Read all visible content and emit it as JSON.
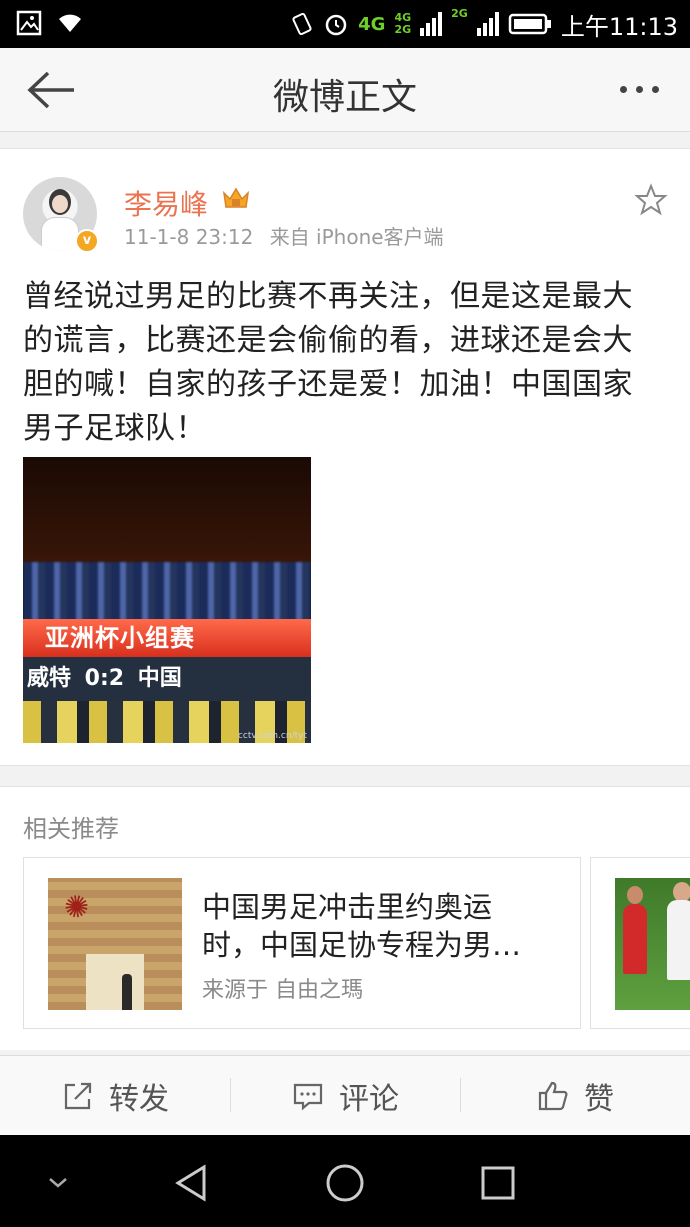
{
  "status_bar": {
    "network_main": "4G",
    "network_small_top": "4G",
    "network_small_bottom": "2G",
    "network_alt": "2G",
    "time": "上午11:13"
  },
  "nav": {
    "title": "微博正文"
  },
  "post": {
    "author": "李易峰",
    "date": "11-1-8 23:12",
    "source": "来自 iPhone客户端",
    "text": "曾经说过男足的比赛不再关注，但是这是最大的谎言，比赛还是会偷偷的看，进球还是会大胆的喊！自家的孩子还是爱！加油！中国国家男子足球队！",
    "image": {
      "banner": "亚洲杯小组赛",
      "score": "威特 0:2 中国",
      "watermark": "cctv.com.cn/tyt"
    },
    "verified_badge": "v",
    "accent_color": "#eb7350"
  },
  "related": {
    "title": "相关推荐",
    "items": [
      {
        "headline": "中国男足冲击里约奥运时，中国足协专程为男…",
        "source": "来源于 自由之瑪"
      }
    ]
  },
  "actions": {
    "repost": "转发",
    "comment": "评论",
    "like": "赞"
  },
  "icons": {
    "back": "arrow-left-icon",
    "more": "more-dots-icon",
    "favorite": "star-icon",
    "repost": "share-icon",
    "comment": "comment-icon",
    "like": "thumbs-up-icon"
  }
}
